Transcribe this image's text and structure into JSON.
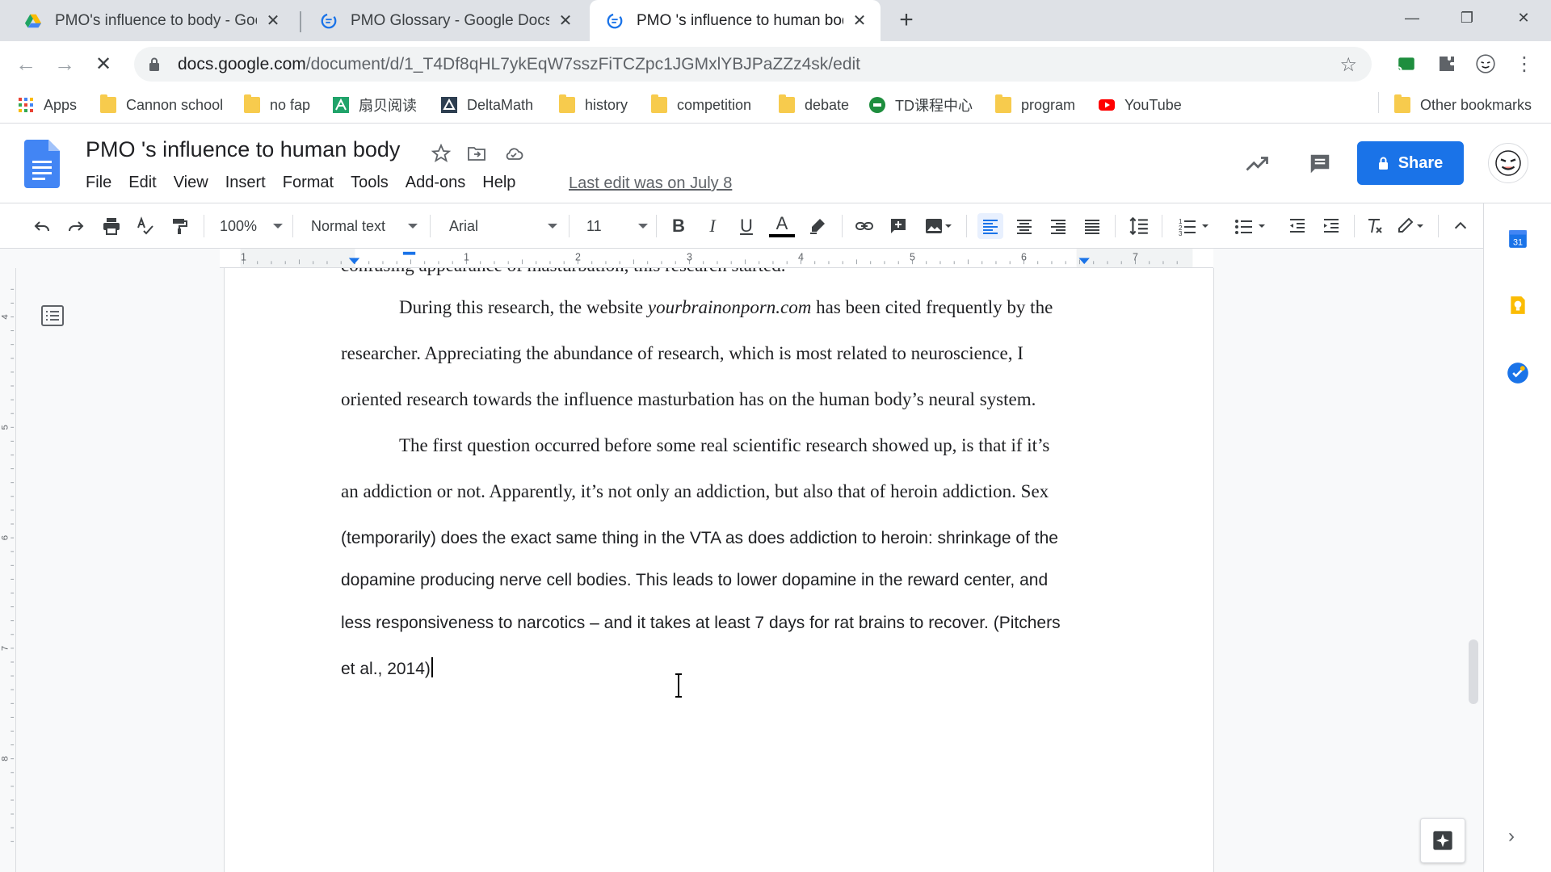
{
  "browser": {
    "tabs": [
      {
        "title": "PMO's influence to body - Google Drive",
        "active": false
      },
      {
        "title": "PMO Glossary - Google Docs",
        "active": false
      },
      {
        "title": "PMO 's influence to human body - Google Docs",
        "active": true
      }
    ],
    "close_glyph": "✕",
    "new_tab_glyph": "+",
    "window_controls": {
      "minimize": "—",
      "restore": "❐",
      "close": "✕"
    },
    "url_host": "docs.google.com",
    "url_path": "/document/d/1_T4Df8qHL7ykEqW7sszFiTCZpc1JGMxlYBJPaZZz4sk/edit",
    "star_glyph": "☆",
    "back_glyph": "←",
    "forward_glyph": "→",
    "stop_glyph": "✕",
    "menu_glyph": "⋮"
  },
  "bookmarks": {
    "items": [
      "Apps",
      "Cannon school",
      "no fap",
      "扇贝阅读",
      "DeltaMath",
      "history",
      "competition",
      "debate",
      "TD课程中心",
      "program",
      "YouTube"
    ],
    "other": "Other bookmarks"
  },
  "docs": {
    "title": "PMO 's influence to human body",
    "menu": [
      "File",
      "Edit",
      "View",
      "Insert",
      "Format",
      "Tools",
      "Add-ons",
      "Help"
    ],
    "last_edit": "Last edit was on July 8",
    "share_label": "Share"
  },
  "format_toolbar": {
    "zoom": "100%",
    "style": "Normal text",
    "font": "Arial",
    "font_size": "11",
    "bold": "B",
    "italic": "I",
    "underline": "U",
    "text_color": "A"
  },
  "ruler": {
    "labels": [
      "1",
      "1",
      "2",
      "3",
      "4",
      "5",
      "6",
      "7"
    ],
    "vlabels": [
      "4",
      "5",
      "6",
      "7",
      "8"
    ]
  },
  "document": {
    "partial_line": "confusing appearance of masturbation, this research started.",
    "p1_l1_a": "During this research, the website ",
    "p1_l1_site": "yourbrainonporn.com",
    "p1_l1_b": " has been cited frequently by the",
    "p1_l2": "researcher. Appreciating the abundance of research, which is most related to neuroscience,  I",
    "p1_l3": "oriented research  towards the influence masturbation has on the human body’s neural system.",
    "p2_l1": "The first question occurred before some real scientific research showed up, is that if it’s",
    "p2_l2": "an addiction or not. Apparently, it’s not only an addiction, but also that of heroin addiction. Sex",
    "p2_l3": "(temporarily) does the exact same thing in the VTA as does addiction to heroin: shrinkage of the",
    "p2_l4": "dopamine producing nerve cell bodies. This leads to lower dopamine in the reward center, and",
    "p2_l5": "less responsiveness to narcotics – and it takes at least 7 days for rat brains to recover. (Pitchers",
    "p2_l6": "et al., 2014)"
  },
  "side_panel": {
    "calendar_day": "31",
    "chevron": "›"
  },
  "colors": {
    "accent": "#1a73e8",
    "tabstrip": "#dee1e6",
    "folder": "#f7cb4d",
    "youtube": "#ff0000"
  }
}
